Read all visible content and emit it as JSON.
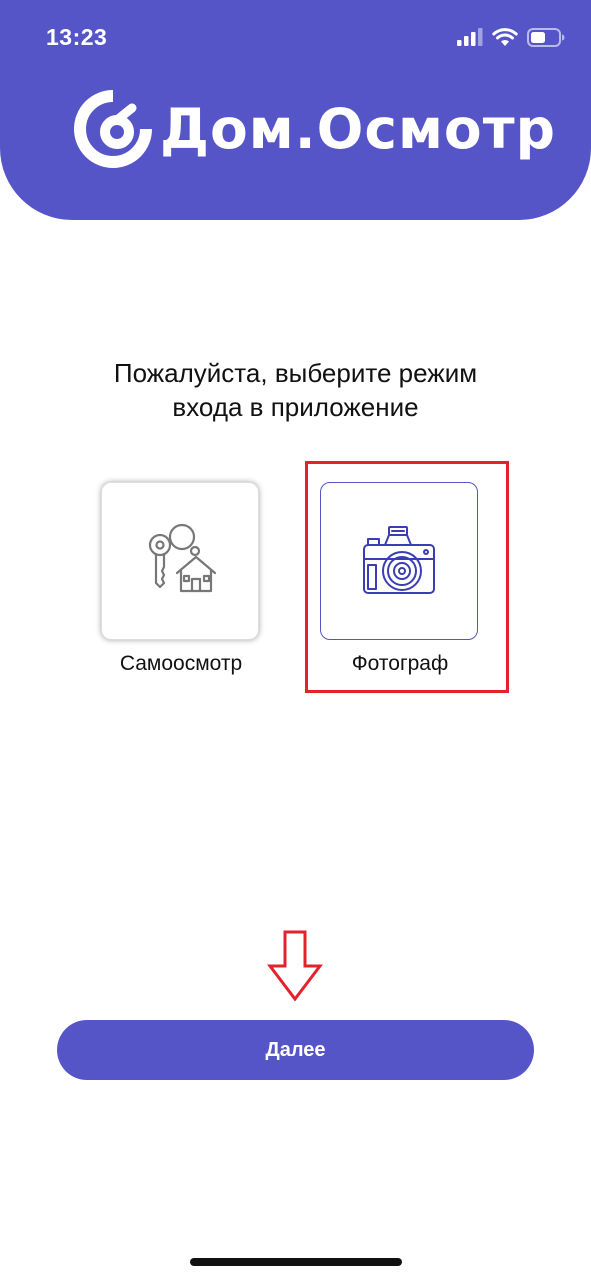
{
  "status_bar": {
    "time": "13:23",
    "icons": [
      "signal-icon",
      "wifi-icon",
      "battery-icon"
    ]
  },
  "header": {
    "brand": "Дом.Осмотр",
    "logo_icon": "brand-logo-icon",
    "background_color": "#5655c8"
  },
  "prompt": {
    "line1": "Пожалуйста, выберите режим",
    "line2": "входа в приложение"
  },
  "options": [
    {
      "label": "Самоосмотр",
      "icon": "keys-house-icon",
      "selected": false
    },
    {
      "label": "Фотограф",
      "icon": "camera-icon",
      "selected": true
    }
  ],
  "annotation": {
    "highlight_color": "#e3222e",
    "arrow_icon": "down-arrow-icon"
  },
  "next_button": {
    "label": "Далее"
  },
  "colors": {
    "accent": "#5655c8",
    "annotation": "#e3222e"
  }
}
